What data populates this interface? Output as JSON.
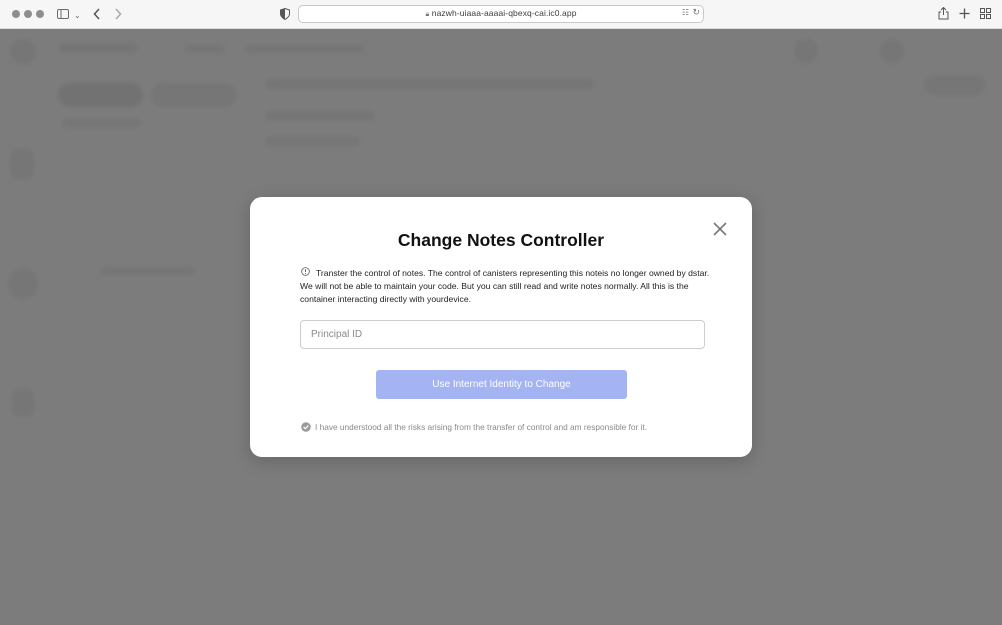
{
  "browser": {
    "url": "nazwh-uiaaa-aaaai-qbexq-cai.ic0.app",
    "icons": [
      "sidebar-icon",
      "back-icon",
      "forward-icon",
      "shield-icon",
      "lock-icon",
      "translate-icon",
      "reload-icon",
      "share-icon",
      "new-tab-icon",
      "tab-overview-icon"
    ]
  },
  "modal": {
    "title": "Change Notes Controller",
    "description": "Transter the control of notes. The control of canisters representing this noteis no longer owned by dstar. We will not be able to maintain your code. But you can still read and write notes normally. All this is the container interacting directly with yourdevice.",
    "principal_placeholder": "Principal ID",
    "principal_value": "",
    "button_label": "Use Internet Identity to Change",
    "agreement": "I have understood all the risks arising from the transfer of control and am responsible for it.",
    "agreement_checked": true
  },
  "colors": {
    "button": "#a4b3f2",
    "overlay": "#5c5c5c"
  }
}
